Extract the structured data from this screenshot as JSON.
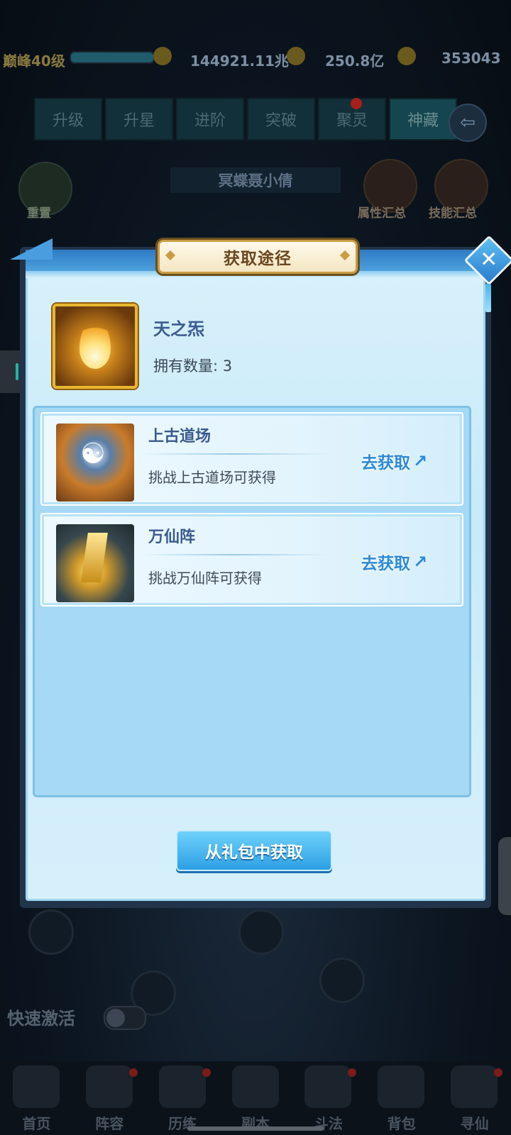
{
  "background": {
    "level_text": "巅峰40级",
    "exp_progress": 0.6,
    "currencies": [
      {
        "icon": "ingot-icon",
        "value": "144921.11兆"
      },
      {
        "icon": "copper-coin-icon",
        "value": "250.8亿"
      },
      {
        "icon": "gold-ingot-icon",
        "value": "353043"
      }
    ],
    "tabs": [
      "升级",
      "升星",
      "进阶",
      "突破",
      "聚灵",
      "神藏"
    ],
    "active_tab": "神藏",
    "reset_label": "重置",
    "character_name": "冥蝶聂小倩",
    "attr_summary_label": "属性汇总",
    "skill_summary_label": "技能汇总",
    "quick_activate_label": "快速激活",
    "quick_activate_on": false,
    "bottom_nav": [
      "首页",
      "阵容",
      "历练",
      "副本",
      "斗法",
      "背包",
      "寻仙"
    ]
  },
  "popup": {
    "title": "获取途径",
    "item": {
      "name": "天之炁",
      "icon": "golden-flame-icon",
      "owned_label": "拥有数量:",
      "owned_count": "3"
    },
    "sources": [
      {
        "title": "上古道场",
        "desc": "挑战上古道场可获得",
        "action": "去获取",
        "image": "ancient-dojo-bagua-image"
      },
      {
        "title": "万仙阵",
        "desc": "挑战万仙阵可获得",
        "action": "去获取",
        "image": "immortal-array-image"
      }
    ],
    "gift_button": "从礼包中获取",
    "close_icon": "close-icon"
  },
  "colors": {
    "panel_bg": "#d9f1fb",
    "header_blue": "#2f7bc4",
    "button_blue": "#2d9fe4",
    "title_text": "#6a4720",
    "link_blue": "#2d8ad9"
  }
}
